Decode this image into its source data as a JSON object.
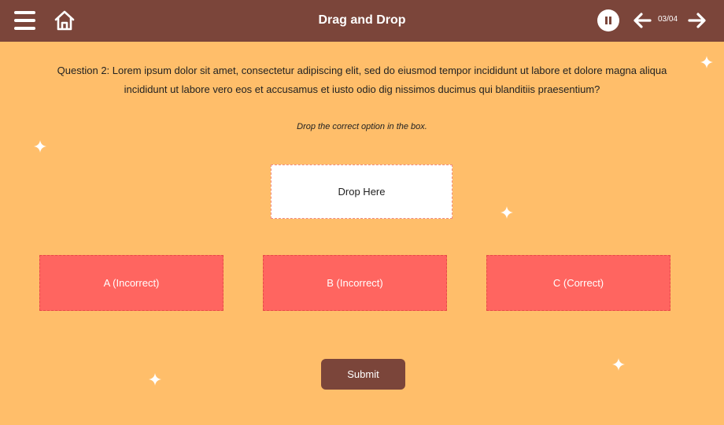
{
  "header": {
    "title": "Drag and Drop",
    "page_indicator": "03/04",
    "menu_icon": "hamburger-menu-icon",
    "home_icon": "home-icon",
    "pause_icon": "pause-icon",
    "prev_icon": "arrow-left-icon",
    "next_icon": "arrow-right-icon"
  },
  "question": {
    "text": "Question 2: Lorem ipsum dolor sit amet, consectetur adipiscing elit, sed do eiusmod tempor incididunt ut labore et dolore magna aliqua incididunt ut labore vero eos et accusamus et iusto odio dig nissimos ducimus qui blanditiis praesentium?",
    "instruction": "Drop the correct option in the box."
  },
  "dropzone": {
    "label": "Drop Here"
  },
  "options": [
    {
      "label": "A (Incorrect)"
    },
    {
      "label": "B (Incorrect)"
    },
    {
      "label": "C (Correct)"
    }
  ],
  "submit_label": "Submit",
  "colors": {
    "header_bg": "#7B453A",
    "page_bg": "#FFBE6A",
    "option_bg": "#FF6560",
    "dropzone_bg": "#FFFFFF",
    "submit_bg": "#7B453A"
  }
}
